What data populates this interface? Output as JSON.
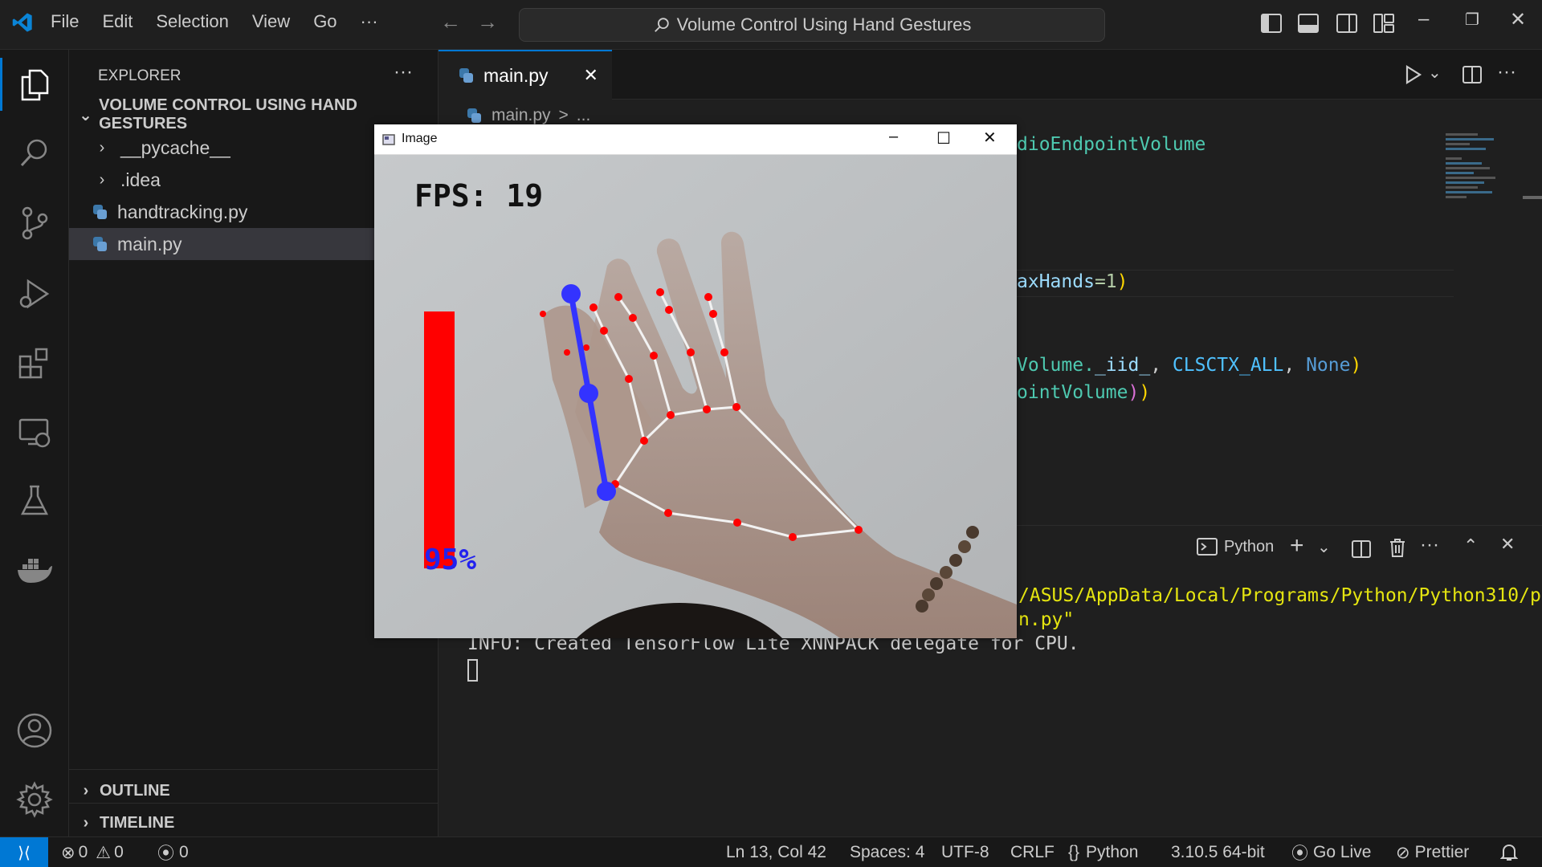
{
  "titlebar": {
    "menu": [
      "File",
      "Edit",
      "Selection",
      "View",
      "Go",
      "···"
    ],
    "search": "Volume Control Using Hand Gestures"
  },
  "explorer": {
    "header": "EXPLORER",
    "more": "···",
    "project": "VOLUME CONTROL USING HAND GESTURES",
    "items": [
      {
        "label": "__pycache__",
        "type": "folder"
      },
      {
        "label": ".idea",
        "type": "folder"
      },
      {
        "label": "handtracking.py",
        "type": "python"
      },
      {
        "label": "main.py",
        "type": "python"
      }
    ],
    "outline": "OUTLINE",
    "timeline": "TIMELINE"
  },
  "editor": {
    "tab": "main.py",
    "breadcrumb_file": "main.py",
    "breadcrumb_sep": ">",
    "breadcrumb_more": "...",
    "code": {
      "l1": "dioEndpointVolume",
      "l2_a": "axHands",
      "l2_b": "=1",
      "l2_c": ")",
      "l3_a": "Volume.",
      "l3_b": "_iid_",
      "l3_c": ", ",
      "l3_d": "CLSCTX_ALL",
      "l3_e": ", ",
      "l3_f": "None",
      "l3_g": ")",
      "l4_a": "ointVolume",
      "l4_b": ")",
      "l4_c": ")"
    }
  },
  "panel": {
    "terminal_name": "Python",
    "line1": "/ASUS/AppData/Local/Programs/Python/Python310/p",
    "line2": "n.py\"",
    "line3": "INFO: Created TensorFlow Lite XNNPACK delegate for CPU."
  },
  "statusbar": {
    "errors": "0",
    "warnings": "0",
    "ports": "0",
    "position": "Ln 13, Col 42",
    "spaces": "Spaces: 4",
    "encoding": "UTF-8",
    "eol": "CRLF",
    "language": "Python",
    "interpreter": "3.10.5 64-bit",
    "golive": "Go Live",
    "prettier": "Prettier"
  },
  "image_window": {
    "title": "Image",
    "fps": "FPS: 19",
    "volume_percent": "95%",
    "volume_level": 0.95
  },
  "colors": {
    "accent": "#0078d4",
    "volume_bar": "#ff0000",
    "gesture_line": "#3333ff",
    "landmark": "#ff0000"
  }
}
